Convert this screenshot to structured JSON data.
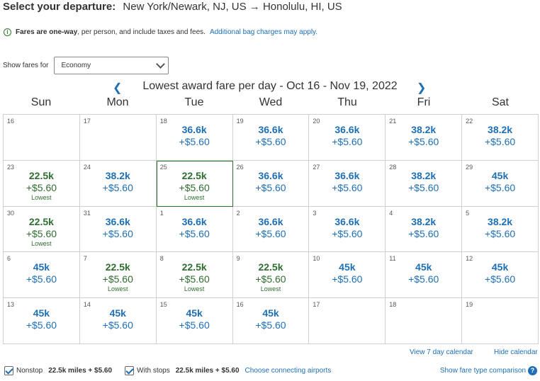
{
  "header": {
    "label": "Select your departure:",
    "route": "New York/Newark, NJ, US → Honolulu, HI, US"
  },
  "notice": {
    "bold": "Fares are one-way",
    "text": ", per person, and include taxes and fees.",
    "link": "Additional bag charges may apply."
  },
  "fares_for": {
    "label": "Show fares for",
    "selected": "Economy"
  },
  "calendar": {
    "title": "Lowest award fare per day - Oct 16 - Nov 19, 2022",
    "days_of_week": [
      "Sun",
      "Mon",
      "Tue",
      "Wed",
      "Thu",
      "Fri",
      "Sat"
    ],
    "cells": [
      {
        "day": "16",
        "miles": "",
        "tax": "",
        "lowest": "",
        "color": "blue"
      },
      {
        "day": "17",
        "miles": "",
        "tax": "",
        "lowest": "",
        "color": "blue"
      },
      {
        "day": "18",
        "miles": "36.6k",
        "tax": "+$5.60",
        "lowest": "",
        "color": "blue"
      },
      {
        "day": "19",
        "miles": "36.6k",
        "tax": "+$5.60",
        "lowest": "",
        "color": "blue"
      },
      {
        "day": "20",
        "miles": "36.6k",
        "tax": "+$5.60",
        "lowest": "",
        "color": "blue"
      },
      {
        "day": "21",
        "miles": "38.2k",
        "tax": "+$5.60",
        "lowest": "",
        "color": "blue"
      },
      {
        "day": "22",
        "miles": "38.2k",
        "tax": "+$5.60",
        "lowest": "",
        "color": "blue"
      },
      {
        "day": "23",
        "miles": "22.5k",
        "tax": "+$5.60",
        "lowest": "Lowest",
        "color": "green"
      },
      {
        "day": "24",
        "miles": "38.2k",
        "tax": "+$5.60",
        "lowest": "",
        "color": "blue"
      },
      {
        "day": "25",
        "miles": "22.5k",
        "tax": "+$5.60",
        "lowest": "Lowest",
        "color": "green",
        "selected": true
      },
      {
        "day": "26",
        "miles": "36.6k",
        "tax": "+$5.60",
        "lowest": "",
        "color": "blue"
      },
      {
        "day": "27",
        "miles": "36.6k",
        "tax": "+$5.60",
        "lowest": "",
        "color": "blue"
      },
      {
        "day": "28",
        "miles": "38.2k",
        "tax": "+$5.60",
        "lowest": "",
        "color": "blue"
      },
      {
        "day": "29",
        "miles": "45k",
        "tax": "+$5.60",
        "lowest": "",
        "color": "blue"
      },
      {
        "day": "30",
        "miles": "22.5k",
        "tax": "+$5.60",
        "lowest": "Lowest",
        "color": "green"
      },
      {
        "day": "31",
        "miles": "36.6k",
        "tax": "+$5.60",
        "lowest": "",
        "color": "blue"
      },
      {
        "day": "1",
        "miles": "36.6k",
        "tax": "+$5.60",
        "lowest": "",
        "color": "blue"
      },
      {
        "day": "2",
        "miles": "36.6k",
        "tax": "+$5.60",
        "lowest": "",
        "color": "blue"
      },
      {
        "day": "3",
        "miles": "36.6k",
        "tax": "+$5.60",
        "lowest": "",
        "color": "blue"
      },
      {
        "day": "4",
        "miles": "38.2k",
        "tax": "+$5.60",
        "lowest": "",
        "color": "blue"
      },
      {
        "day": "5",
        "miles": "38.2k",
        "tax": "+$5.60",
        "lowest": "",
        "color": "blue"
      },
      {
        "day": "6",
        "miles": "45k",
        "tax": "+$5.60",
        "lowest": "",
        "color": "blue"
      },
      {
        "day": "7",
        "miles": "22.5k",
        "tax": "+$5.60",
        "lowest": "Lowest",
        "color": "green"
      },
      {
        "day": "8",
        "miles": "22.5k",
        "tax": "+$5.60",
        "lowest": "Lowest",
        "color": "green"
      },
      {
        "day": "9",
        "miles": "22.5k",
        "tax": "+$5.60",
        "lowest": "Lowest",
        "color": "green"
      },
      {
        "day": "10",
        "miles": "45k",
        "tax": "+$5.60",
        "lowest": "",
        "color": "blue"
      },
      {
        "day": "11",
        "miles": "45k",
        "tax": "+$5.60",
        "lowest": "",
        "color": "blue"
      },
      {
        "day": "12",
        "miles": "45k",
        "tax": "+$5.60",
        "lowest": "",
        "color": "blue"
      },
      {
        "day": "13",
        "miles": "45k",
        "tax": "+$5.60",
        "lowest": "",
        "color": "blue"
      },
      {
        "day": "14",
        "miles": "45k",
        "tax": "+$5.60",
        "lowest": "",
        "color": "blue"
      },
      {
        "day": "15",
        "miles": "45k",
        "tax": "+$5.60",
        "lowest": "",
        "color": "blue"
      },
      {
        "day": "16",
        "miles": "45k",
        "tax": "+$5.60",
        "lowest": "",
        "color": "blue"
      },
      {
        "day": "17",
        "miles": "",
        "tax": "",
        "lowest": "",
        "color": "blue"
      },
      {
        "day": "18",
        "miles": "",
        "tax": "",
        "lowest": "",
        "color": "blue"
      },
      {
        "day": "19",
        "miles": "",
        "tax": "",
        "lowest": "",
        "color": "blue"
      }
    ]
  },
  "links": {
    "view7": "View 7 day calendar",
    "hide": "Hide calendar"
  },
  "filters": {
    "nonstop_label": "Nonstop",
    "nonstop_value": "22.5k miles + $5.60",
    "stops_label": "With stops",
    "stops_value": "22.5k miles + $5.60",
    "connecting": "Choose connecting airports",
    "comparison": "Show fare type comparison"
  },
  "icons": {
    "info": "info-icon",
    "help": "help-icon",
    "prev": "chevron-left-icon",
    "next": "chevron-right-icon"
  },
  "colors": {
    "blue": "#1e6fb5",
    "green": "#2f6e30"
  }
}
